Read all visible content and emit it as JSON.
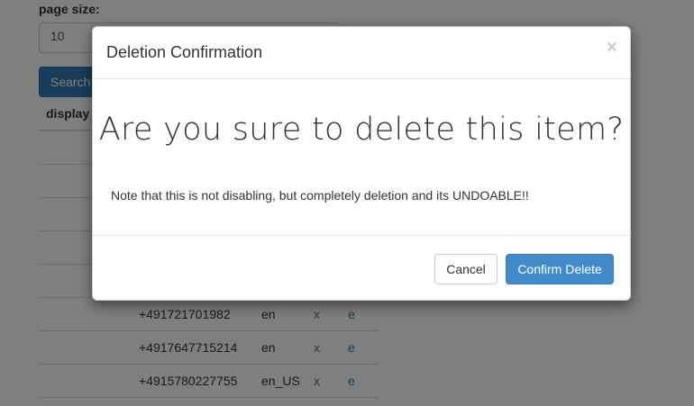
{
  "background": {
    "page_size_label": "page size:",
    "page_size_value": "10",
    "search_label": "Search",
    "column_display": "display",
    "rows": [
      {
        "phone": "+491721701982",
        "locale": "en",
        "delete": "x",
        "edit": "e"
      },
      {
        "phone": "+4917647715214",
        "locale": "en",
        "delete": "x",
        "edit": "e"
      },
      {
        "phone": "+4915780227755",
        "locale": "en_US",
        "delete": "x",
        "edit": "e"
      }
    ]
  },
  "modal": {
    "title": "Deletion Confirmation",
    "close_symbol": "×",
    "heading": "Are you sure to delete this item?",
    "note": "Note that this is not disabling, but completely deletion and its UNDOABLE!!",
    "cancel_label": "Cancel",
    "confirm_label": "Confirm Delete"
  },
  "colors": {
    "primary": "#428bca",
    "link": "#337ab7",
    "backdrop": "rgba(0,0,0,0.5)"
  }
}
